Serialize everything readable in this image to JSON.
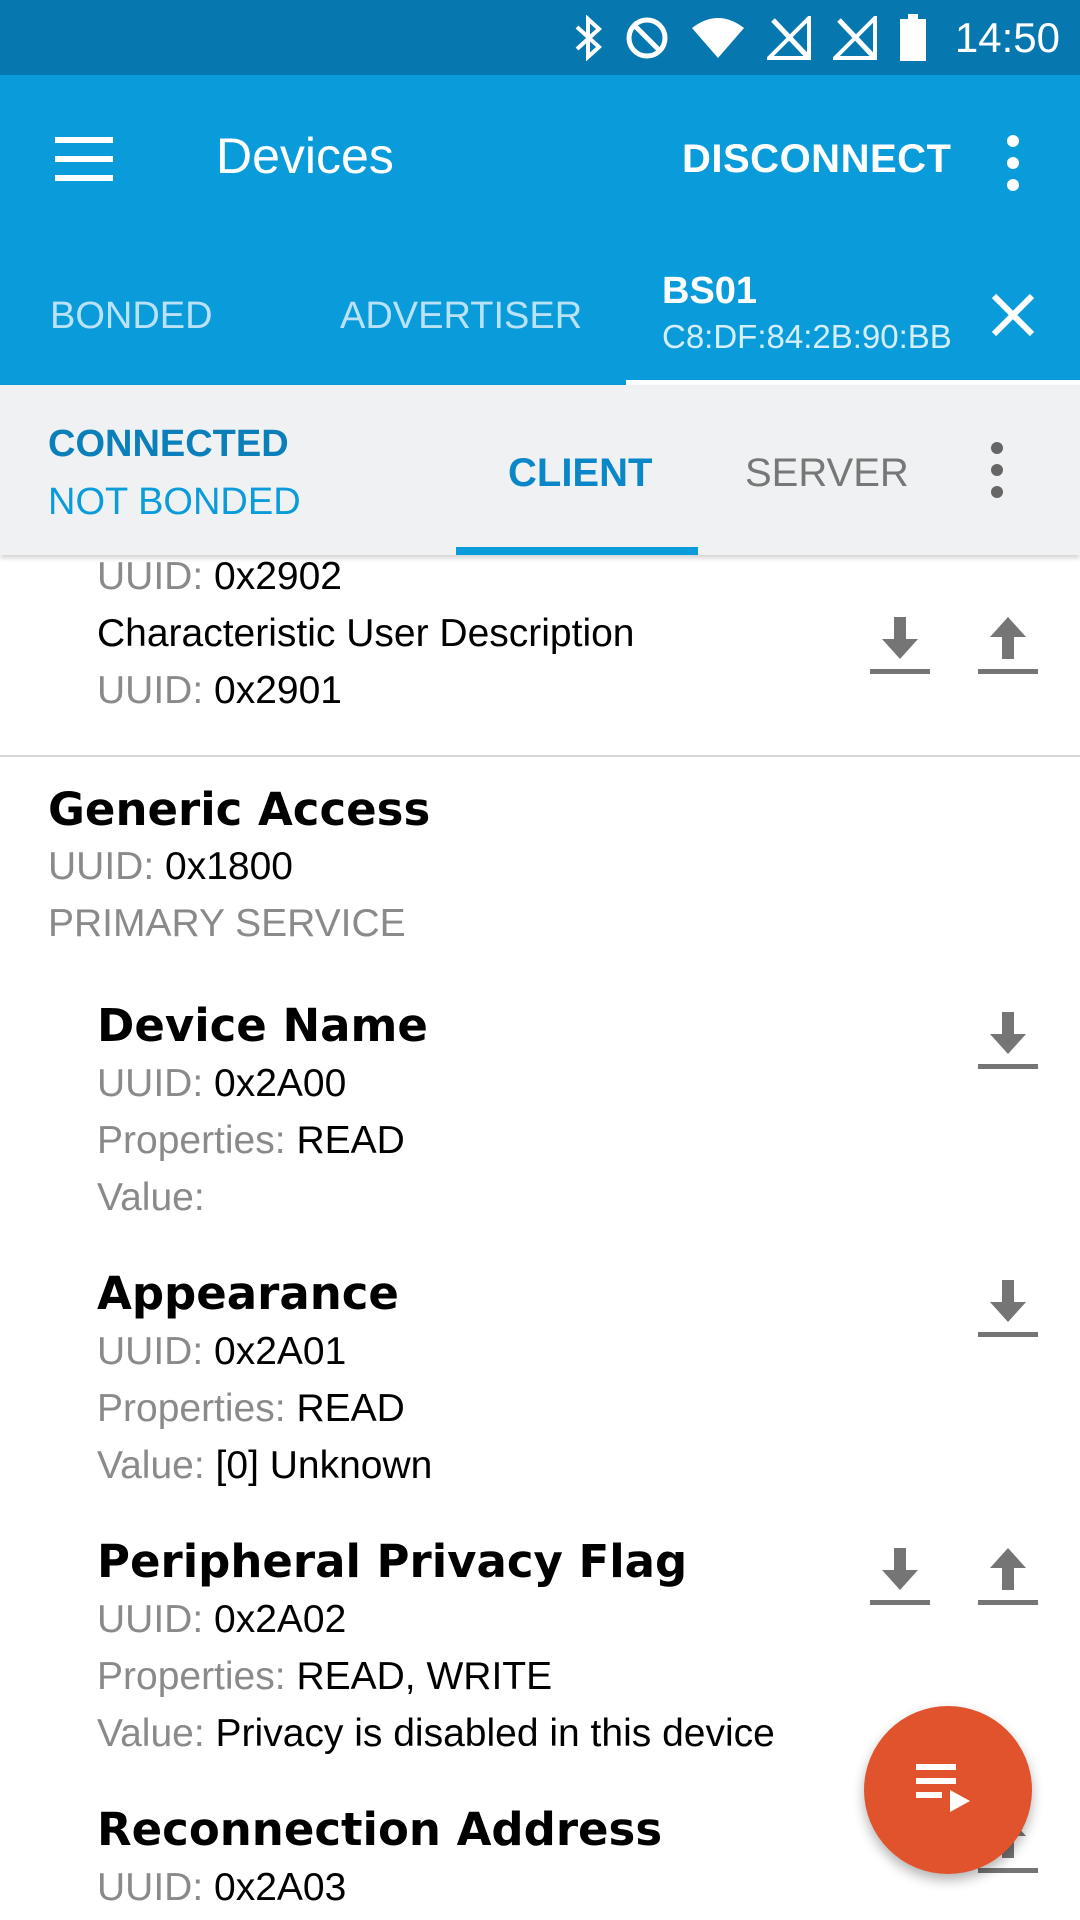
{
  "status_bar": {
    "time": "14:50",
    "icons": [
      "bluetooth-icon",
      "do-not-disturb-icon",
      "wifi-icon",
      "no-signal-icon",
      "no-signal-icon",
      "battery-icon"
    ]
  },
  "app_bar": {
    "title": "Devices",
    "disconnect_label": "DISCONNECT",
    "tabs": {
      "bonded": "BONDED",
      "advertiser": "ADVERTISER",
      "device_name": "BS01",
      "device_address": "C8:DF:84:2B:90:BB"
    }
  },
  "sub_bar": {
    "connection_state": "CONNECTED",
    "bond_state": "NOT BONDED",
    "client_tab": "CLIENT",
    "server_tab": "SERVER"
  },
  "labels": {
    "uuid": "UUID:",
    "properties": "Properties:",
    "value": "Value:"
  },
  "partial_descriptors": [
    {
      "uuid": "0x2902"
    },
    {
      "name": "Characteristic User Description",
      "uuid": "0x2901"
    }
  ],
  "service": {
    "name": "Generic Access",
    "uuid": "0x1800",
    "type": "PRIMARY SERVICE"
  },
  "characteristics": [
    {
      "name": "Device Name",
      "uuid": "0x2A00",
      "properties": "READ",
      "value": ""
    },
    {
      "name": "Appearance",
      "uuid": "0x2A01",
      "properties": "READ",
      "value": "[0] Unknown"
    },
    {
      "name": "Peripheral Privacy Flag",
      "uuid": "0x2A02",
      "properties": "READ, WRITE",
      "value": "Privacy is disabled in this device"
    },
    {
      "name": "Reconnection Address",
      "uuid": "0x2A03"
    }
  ],
  "colors": {
    "status_bar": "#0777af",
    "app_bar": "#0a9bdb",
    "fab": "#e1532c",
    "accent": "#0a87c9"
  }
}
